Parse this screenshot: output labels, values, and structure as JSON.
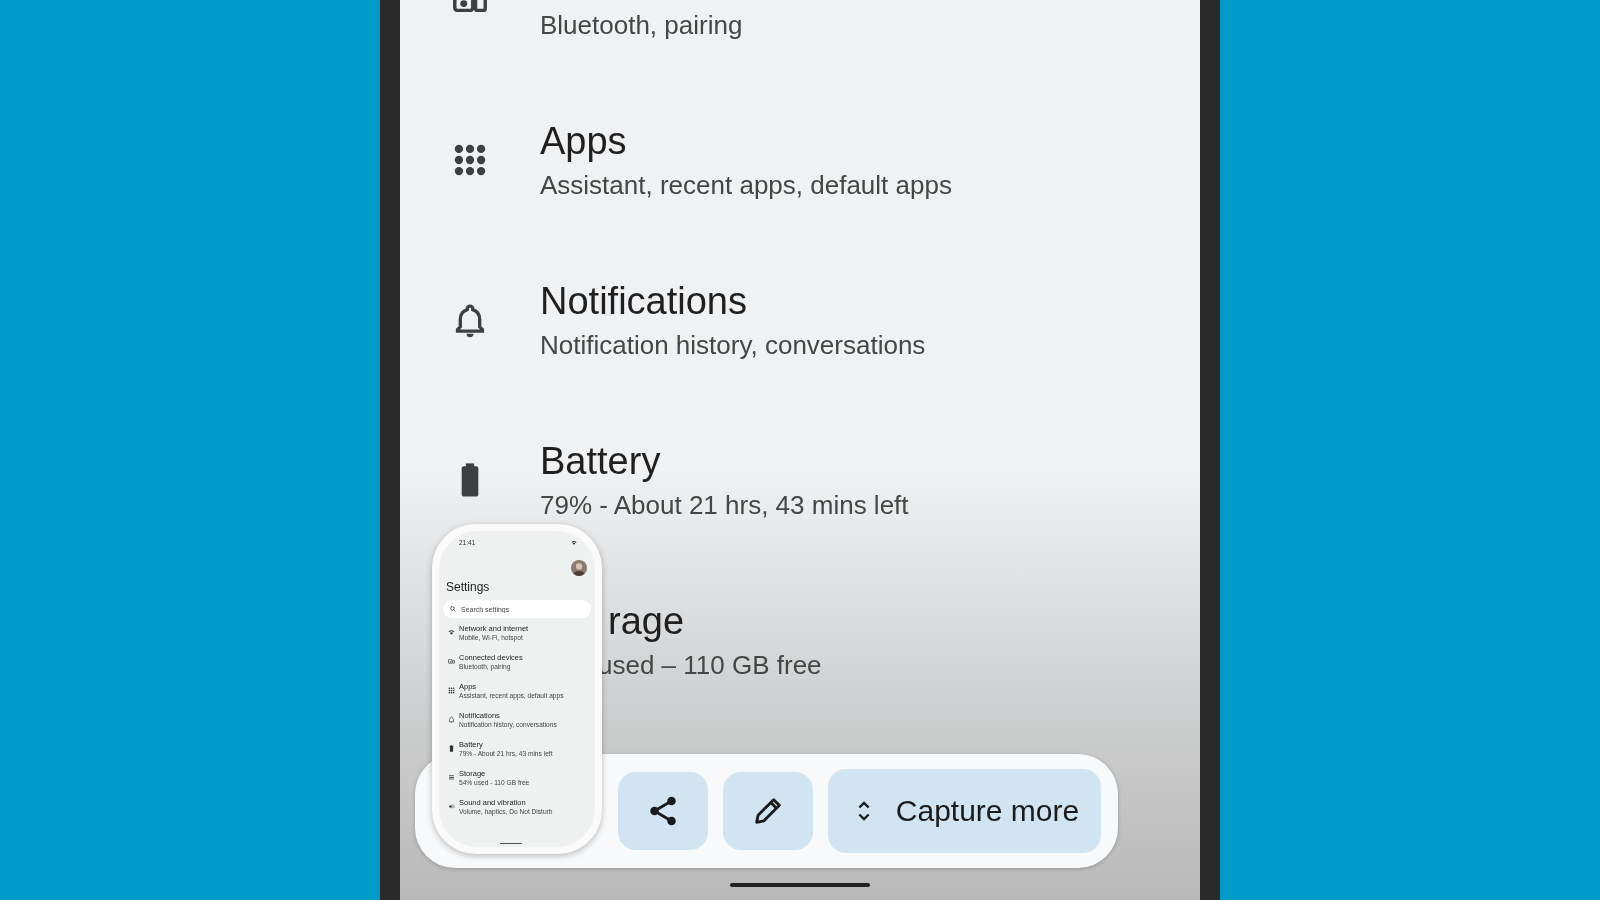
{
  "settings_items": [
    {
      "kind": "cut",
      "subtitle": "Bluetooth, pairing"
    },
    {
      "kind": "full",
      "title": "Apps",
      "subtitle": "Assistant, recent apps, default apps"
    },
    {
      "kind": "full",
      "title": "Notifications",
      "subtitle": "Notification history, conversations"
    },
    {
      "kind": "full",
      "title": "Battery",
      "subtitle": "79% - About 21 hrs, 43 mins left"
    },
    {
      "kind": "covered",
      "title": "rage",
      "subtitle": "used – 110 GB free"
    }
  ],
  "preview": {
    "status_time": "21:41",
    "title": "Settings",
    "search": {
      "placeholder": "Search settings"
    },
    "items": [
      {
        "title": "Network and internet",
        "subtitle": "Mobile, Wi-Fi, hotspot"
      },
      {
        "title": "Connected devices",
        "subtitle": "Bluetooth, pairing"
      },
      {
        "title": "Apps",
        "subtitle": "Assistant, recent apps, default apps"
      },
      {
        "title": "Notifications",
        "subtitle": "Notification history, conversations"
      },
      {
        "title": "Battery",
        "subtitle": "79% - About 21 hrs, 43 mins left"
      },
      {
        "title": "Storage",
        "subtitle": "54% used - 110 GB free"
      },
      {
        "title": "Sound and vibration",
        "subtitle": "Volume, haptics, Do Not Disturb"
      }
    ]
  },
  "toolbar": {
    "buttons": [
      {
        "kind": "share"
      },
      {
        "kind": "edit"
      },
      {
        "kind": "capture",
        "label": "Capture more"
      }
    ]
  }
}
